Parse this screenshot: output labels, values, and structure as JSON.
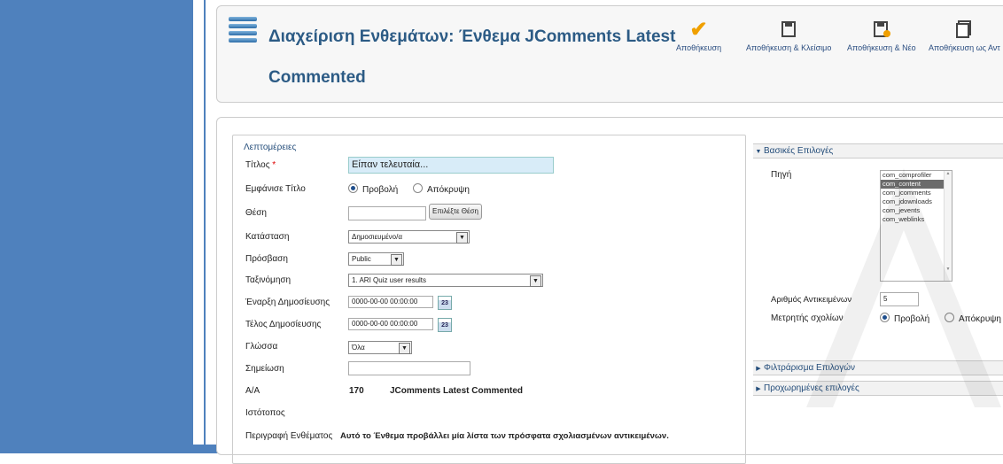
{
  "header": {
    "title_line1": "Διαχείριση Ενθεμάτων: Ένθεμα JComments Latest",
    "title_line2": "Commented"
  },
  "toolbar": {
    "save": "Αποθήκευση",
    "save_close": "Αποθήκευση & Κλείσιμο",
    "save_new": "Αποθήκευση & Νέο",
    "save_copy": "Αποθήκευση ως Αντ"
  },
  "details": {
    "legend": "Λεπτομέρειες",
    "title_label": "Τίτλος",
    "title_required": "*",
    "title_value": "Είπαν τελευταία...",
    "show_title_label": "Εμφάνισε Τίτλο",
    "show_option": "Προβολή",
    "hide_option": "Απόκρυψη",
    "position_label": "Θέση",
    "position_value": "",
    "select_position_button": "Επιλέξτε Θέση",
    "status_label": "Κατάσταση",
    "status_value": "Δημοσιευμένο/α",
    "access_label": "Πρόσβαση",
    "access_value": "Public",
    "ordering_label": "Ταξινόμηση",
    "ordering_value": "1. ARI Quiz user results",
    "start_label": "Έναρξη Δημοσίευσης",
    "start_value": "0000-00-00 00:00:00",
    "end_label": "Τέλος Δημοσίευσης",
    "end_value": "0000-00-00 00:00:00",
    "calendar_day": "23",
    "language_label": "Γλώσσα",
    "language_value": "Όλα",
    "note_label": "Σημείωση",
    "note_value": "",
    "id_label": "Α/Α",
    "id_value": "170",
    "module_name": "JComments Latest Commented",
    "site_label": "Ιστότοπος",
    "description_label": "Περιγραφή Ενθέματος",
    "description_value": "Αυτό το Ένθεμα προβάλλει μία λίστα των πρόσφατα σχολιασμένων αντικειμένων."
  },
  "basic_options": {
    "header": "Βασικές Επιλογές",
    "source_label": "Πηγή",
    "source_options": [
      "com_comprofiler",
      "com_content",
      "com_jcomments",
      "com_jdownloads",
      "com_jevents",
      "com_weblinks"
    ],
    "source_selected": "com_content",
    "count_label": "Αριθμός Αντικειμένων",
    "count_value": "5",
    "comments_counter_label": "Μετρητής σχολίων",
    "show_option": "Προβολή",
    "hide_option": "Απόκρυψη"
  },
  "filter_options": {
    "header": "Φιλτράρισμα Επιλογών"
  },
  "advanced_options": {
    "header": "Προχωρημένες επιλογές"
  },
  "colors": {
    "frame_blue": "#4f81bd",
    "heading_blue": "#2c5b85",
    "accent_orange": "#f0a000"
  }
}
